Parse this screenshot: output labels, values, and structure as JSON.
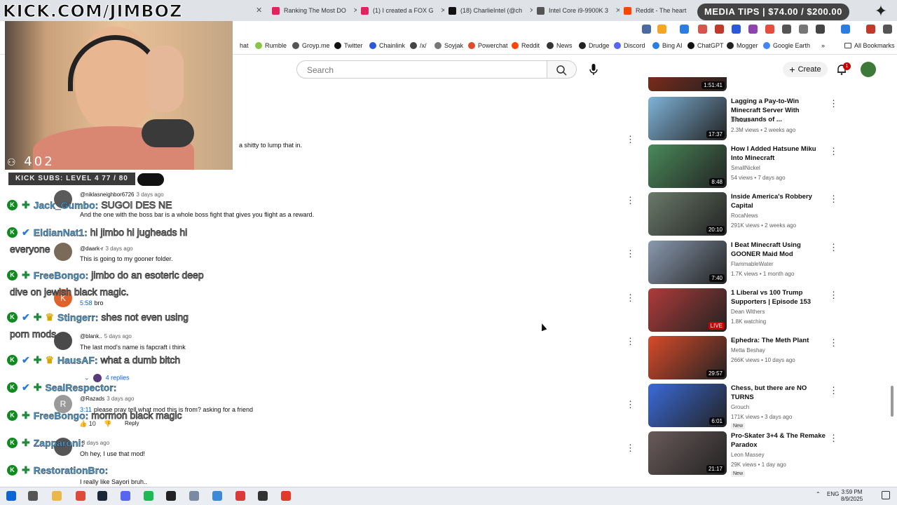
{
  "browser": {
    "tabs": [
      {
        "title": "Ranking The Most DO",
        "color": "#e0245e"
      },
      {
        "title": "(1) I created a FOX G",
        "color": "#e0245e"
      },
      {
        "title": "(18) CharlieIntel (@ch",
        "color": "#111111"
      },
      {
        "title": "Intel Core i9-9900K 3",
        "color": "#555555"
      },
      {
        "title": "Reddit - The heart",
        "color": "#ff4500"
      }
    ],
    "bookmarks": [
      {
        "label": "hat",
        "color": "#888888"
      },
      {
        "label": "Rumble",
        "color": "#85c742"
      },
      {
        "label": "Groyp.me",
        "color": "#555555"
      },
      {
        "label": "Twitter",
        "color": "#111111"
      },
      {
        "label": "Chainlink",
        "color": "#2a5ada"
      },
      {
        "label": "/x/",
        "color": "#444444"
      },
      {
        "label": "Soyjak",
        "color": "#777777"
      },
      {
        "label": "Powerchat",
        "color": "#e04a2c"
      },
      {
        "label": "Reddit",
        "color": "#ff4500"
      },
      {
        "label": "News",
        "color": "#333333"
      },
      {
        "label": "Drudge",
        "color": "#222222"
      },
      {
        "label": "Discord",
        "color": "#5865f2"
      },
      {
        "label": "Bing AI",
        "color": "#2a7de1"
      },
      {
        "label": "ChatGPT",
        "color": "#111111"
      },
      {
        "label": "Mogger",
        "color": "#222222"
      },
      {
        "label": "Google Earth",
        "color": "#4285f4"
      }
    ],
    "all_bookmarks": "All Bookmarks"
  },
  "youtube": {
    "search_placeholder": "Search",
    "create_label": "Create",
    "notif_count": "1"
  },
  "comments": [
    {
      "author": "",
      "time": "",
      "text": "a shitty to lump that in."
    },
    {
      "author": "@niklasneighbor6726",
      "time": "3 days ago",
      "text": "And the one with the boss bar is a whole boss fight that gives you flight as a reward.",
      "avatar": "#5a5a5a"
    },
    {
      "author": "@daark-r",
      "time": "3 days ago",
      "text": "This is going to my gooner folder.",
      "avatar": "#7a6a5a"
    },
    {
      "author": "",
      "time": "",
      "text": "bro",
      "prefix": "5:58",
      "avatar": "#e0622b",
      "avatar_letter": "K"
    },
    {
      "author": "@blank..",
      "time": "5 days ago",
      "text": "The last mod's name is fapcraft i think",
      "avatar": "#4a4a4a"
    },
    {
      "author": "@Razads",
      "time": "3 days ago",
      "text": "please pray tell what mod this is from? asking for a friend",
      "prefix": "3:11",
      "avatar": "#9a9a9a",
      "avatar_letter": "R",
      "likes": "10",
      "reply": "Reply"
    },
    {
      "author": "",
      "time": "3 days ago",
      "text": "Oh hey, I use that mod!",
      "avatar": "#555555"
    },
    {
      "author": "",
      "time": "",
      "text": "I really like Sayori bruh.."
    }
  ],
  "replies_label": "4 replies",
  "recommendations": [
    {
      "title": "",
      "channel": "",
      "meta": "",
      "duration": "1:51:41",
      "thumb": "#7a2a1a"
    },
    {
      "title": "Lagging a Pay-to-Win Minecraft Server With Thousands of ...",
      "channel": "Droobix",
      "meta": "2.3M views • 2 weeks ago",
      "duration": "17:37",
      "thumb": "#7fb3d9"
    },
    {
      "title": "How I Added Hatsune Miku Into Minecraft",
      "channel": "SmallNickel",
      "meta": "54 views • 7 days ago",
      "duration": "8:48",
      "thumb": "#4a8a5a"
    },
    {
      "title": "Inside America's Robbery Capital",
      "channel": "RocaNews",
      "meta": "291K views • 2 weeks ago",
      "duration": "20:10",
      "thumb": "#6a7a6a"
    },
    {
      "title": "I Beat Minecraft Using GOONER Maid Mod",
      "channel": "FlammableWater",
      "meta": "1.7K views • 1 month ago",
      "duration": "7:40",
      "thumb": "#8a9ab0"
    },
    {
      "title": "1 Liberal vs 100 Trump Supporters | Episode 153",
      "channel": "Dean Withers",
      "meta": "1.8K watching",
      "duration": "LIVE",
      "thumb": "#b03a3a"
    },
    {
      "title": "Ephedra: The Meth Plant",
      "channel": "Metta Beshay",
      "meta": "266K views • 10 days ago",
      "duration": "29:57",
      "thumb": "#d94a2a"
    },
    {
      "title": "Chess, but there are NO TURNS",
      "channel": "Grouch",
      "meta": "171K views • 3 days ago",
      "duration": "6:01",
      "thumb": "#3a6ad9",
      "new": "New"
    },
    {
      "title": "Pro-Skater 3+4 & The Remake Paradox",
      "channel": "Leon Massey",
      "meta": "29K views • 1 day ago",
      "duration": "21:17",
      "thumb": "#6a5a5a",
      "new": "New"
    }
  ],
  "overlay": {
    "logo": "KICK.COM/JIMBOZ",
    "viewers": "402",
    "kick_subs": "KICK SUBS: LEVEL 4 77 / 80",
    "media_tips": "MEDIA TIPS | $74.00 / $200.00"
  },
  "chat": [
    {
      "user": "Jack_Gumbo:",
      "msg": "SUGOI DES NE",
      "badges": [
        "k",
        "g"
      ]
    },
    {
      "user": "EldianNat1:",
      "msg": "hi jimbo hi jugheads hi",
      "badges": [
        "k",
        "b"
      ]
    },
    {
      "user": "",
      "msg": "everyone",
      "badges": []
    },
    {
      "user": "FreeBongo:",
      "msg": "jimbo do an esoteric deep",
      "badges": [
        "k",
        "g"
      ]
    },
    {
      "user": "",
      "msg": "dive on jewish black magic.",
      "badges": []
    },
    {
      "user": "Stingerr:",
      "msg": "shes not even using",
      "badges": [
        "k",
        "b",
        "g",
        "c"
      ]
    },
    {
      "user": "",
      "msg": "porn mods",
      "badges": []
    },
    {
      "user": "HausAF:",
      "msg": "what a dumb bitch",
      "badges": [
        "k",
        "b",
        "g",
        "c"
      ]
    },
    {
      "user": "SealRespector:",
      "msg": "",
      "badges": [
        "k",
        "b",
        "g"
      ]
    },
    {
      "user": "FreeBongo:",
      "msg": "mormon black magic",
      "badges": [
        "k",
        "g"
      ]
    },
    {
      "user": "Zapparoni:",
      "msg": "",
      "badges": [
        "k",
        "g"
      ]
    },
    {
      "user": "RestorationBro:",
      "msg": "",
      "badges": [
        "k",
        "g"
      ]
    }
  ],
  "taskbar": {
    "lang": "ENG",
    "time": "3:59 PM",
    "date": "8/9/2025",
    "icons": [
      {
        "name": "start",
        "color": "#0a64d8"
      },
      {
        "name": "task-view",
        "color": "#555555"
      },
      {
        "name": "file-explorer",
        "color": "#e8b84a"
      },
      {
        "name": "chrome",
        "color": "#de4a3a"
      },
      {
        "name": "steam",
        "color": "#1b2838"
      },
      {
        "name": "discord",
        "color": "#5865f2"
      },
      {
        "name": "spotify",
        "color": "#1db954"
      },
      {
        "name": "terminal",
        "color": "#222222"
      },
      {
        "name": "app-8",
        "color": "#7a8aa0"
      },
      {
        "name": "app-9",
        "color": "#3a8ad9"
      },
      {
        "name": "app-10",
        "color": "#d93a3a"
      },
      {
        "name": "app-11",
        "color": "#333333"
      },
      {
        "name": "app-12",
        "color": "#e03a2a"
      }
    ]
  }
}
